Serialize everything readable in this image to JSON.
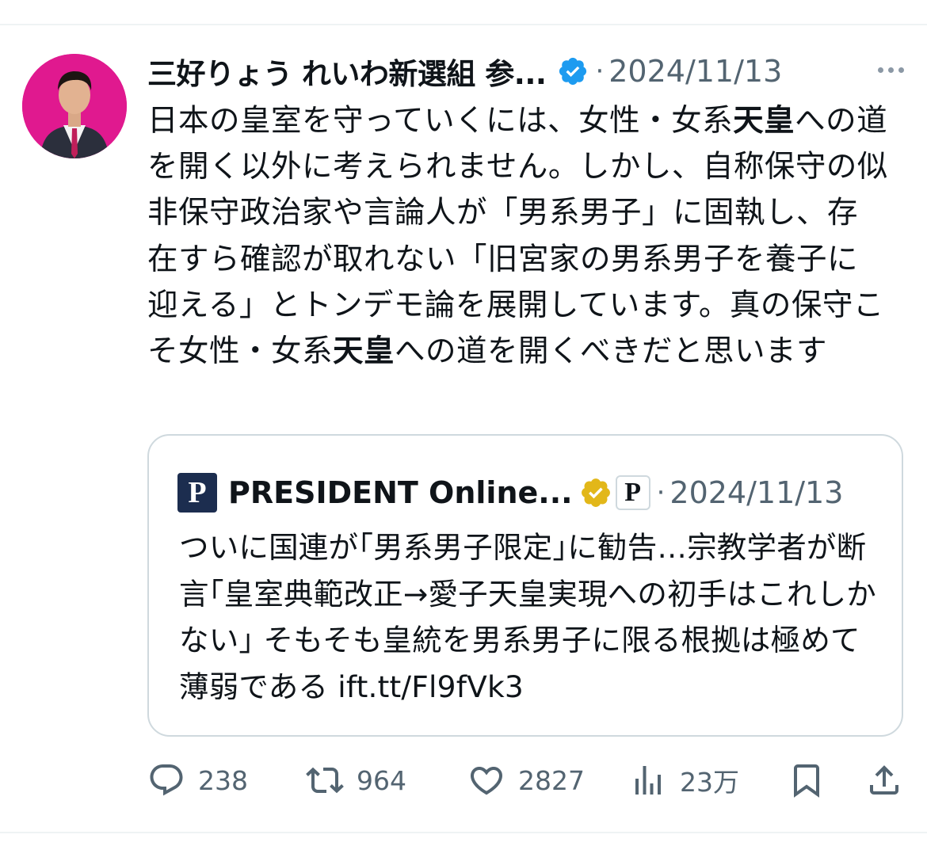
{
  "tweet": {
    "author_name": "三好りょう れいわ新選組 参...",
    "separator": "·",
    "date": "2024/11/13",
    "more_icon": "more-horizontal-icon",
    "verified_icon": "verified-badge-icon",
    "verified_color": "#1d9bf0",
    "avatar_bg_color": "#e0198f",
    "text": {
      "part1": "日本の皇室を守っていくには、女性・女系",
      "bold1": "天皇",
      "part2": "への道を開く以外に考えられません。しかし、自称保守の似非保守政治家や言論人が「男系男子」に固執し、存在すら確認が取れない「旧宮家の男系男子を養子に迎える」とトンデモ論を展開しています。真の保守こそ女性・女系",
      "bold2": "天皇",
      "part3": "への道を開くべきだと思います"
    }
  },
  "quote": {
    "logo_letter": "P",
    "name": "PRESIDENT Online...",
    "badge_icon": "gold-verified-badge-icon",
    "badge_color": "#e2b719",
    "affiliate_letter": "P",
    "separator": "·",
    "date": "2024/11/13",
    "text": "ついに国連が｢男系男子限定｣に勧告…宗教学者が断言｢皇室典範改正→愛子天皇実現への初手はこれしかない｣ そもそも皇統を男系男子に限る根拠は極めて薄弱である ift.tt/Fl9fVk3"
  },
  "actions": {
    "replies": "238",
    "retweets": "964",
    "likes": "2827",
    "views": "23万"
  }
}
